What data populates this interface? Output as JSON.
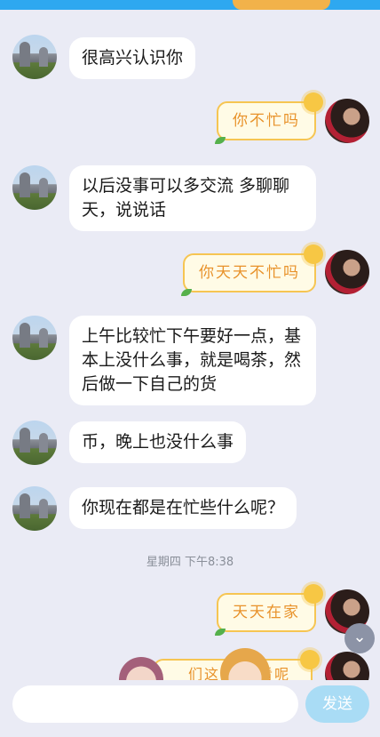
{
  "messages": [
    {
      "side": "left",
      "text": "很高兴认识你"
    },
    {
      "side": "right",
      "text": "你不忙吗"
    },
    {
      "side": "left",
      "text": "以后没事可以多交流 多聊聊天，说说话"
    },
    {
      "side": "right",
      "text": "你天天不忙吗"
    },
    {
      "side": "left",
      "text": "上午比较忙下午要好一点，基本上没什么事，就是喝茶，然后做一下自己的货"
    },
    {
      "side": "left",
      "text": "币，晚上也没什么事"
    },
    {
      "side": "left",
      "text": "你现在都是在忙些什么呢？"
    },
    {
      "side": "right",
      "text": "天天在家"
    }
  ],
  "timestamp": "星期四 下午8:38",
  "partial_sticker_text": "们这疫",
  "partial_sticker_text_right": "看呢",
  "composer": {
    "send_label": "发送",
    "placeholder": ""
  },
  "colors": {
    "bubble_right_text": "#e8922a",
    "accent": "#2ea8f0"
  }
}
